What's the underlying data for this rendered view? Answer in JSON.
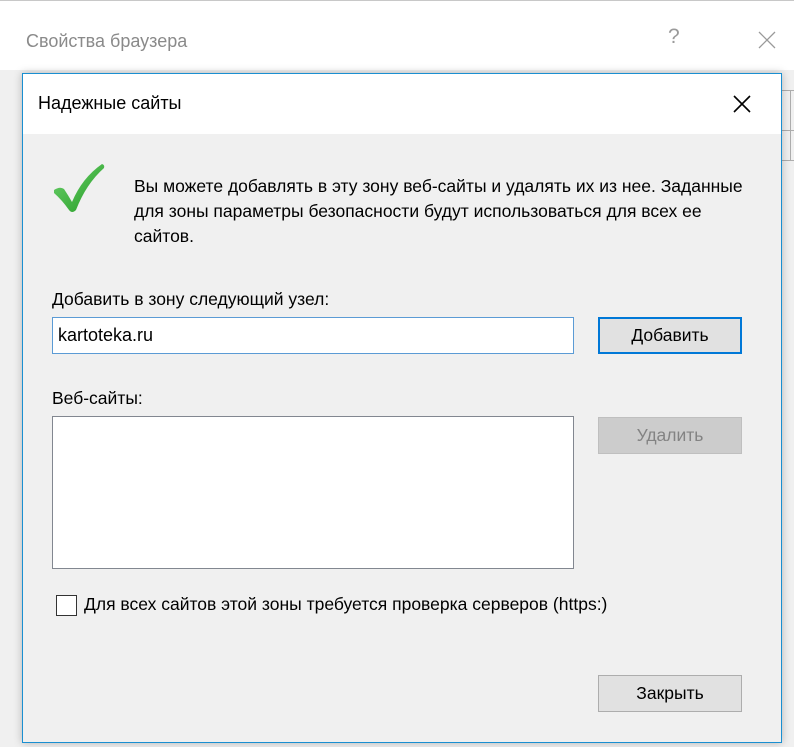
{
  "parent_window": {
    "title": "Свойства браузера",
    "help_label": "?"
  },
  "dialog": {
    "title": "Надежные сайты",
    "info_text": "Вы можете добавлять в эту зону  веб-сайты и удалять их из нее. Заданные для зоны параметры безопасности будут использоваться для всех ее сайтов.",
    "add_label": "Добавить в зону следующий узел:",
    "add_input_value": "kartoteka.ru",
    "add_button": "Добавить",
    "websites_label": "Веб-сайты:",
    "websites": [],
    "remove_button": "Удалить",
    "https_checkbox_label": "Для всех сайтов этой зоны требуется проверка серверов (https:)",
    "https_checkbox_checked": false,
    "close_button": "Закрыть"
  },
  "icons": {
    "info": "check-icon",
    "dialog_close": "close-icon",
    "parent_close": "close-icon"
  },
  "colors": {
    "accent": "#0078d7",
    "check_green": "#3cb43c",
    "dialog_border": "#1a8fd1"
  }
}
